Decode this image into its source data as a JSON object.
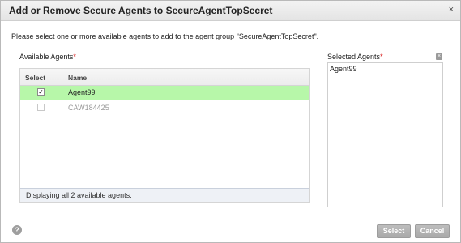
{
  "dialog": {
    "title": "Add or Remove Secure Agents to SecureAgentTopSecret",
    "close_glyph": "×"
  },
  "intro_text": "Please select one or more available agents to add to the agent group \"SecureAgentTopSecret\".",
  "available": {
    "label": "Available Agents",
    "required_mark": "*",
    "columns": {
      "select": "Select",
      "name": "Name"
    },
    "rows": [
      {
        "name": "Agent99",
        "checked": true,
        "enabled": true,
        "check_glyph": "✓"
      },
      {
        "name": "CAW184425",
        "checked": false,
        "enabled": false,
        "check_glyph": ""
      }
    ],
    "status_text": "Displaying all 2 available agents."
  },
  "selected": {
    "label": "Selected Agents",
    "required_mark": "*",
    "items": [
      "Agent99"
    ],
    "clear_glyph": "×"
  },
  "footer": {
    "help_glyph": "?",
    "select_label": "Select",
    "cancel_label": "Cancel"
  },
  "colors": {
    "selected_row": "#b7f7a9",
    "required": "#d40000",
    "button": "#aaaaaa"
  }
}
